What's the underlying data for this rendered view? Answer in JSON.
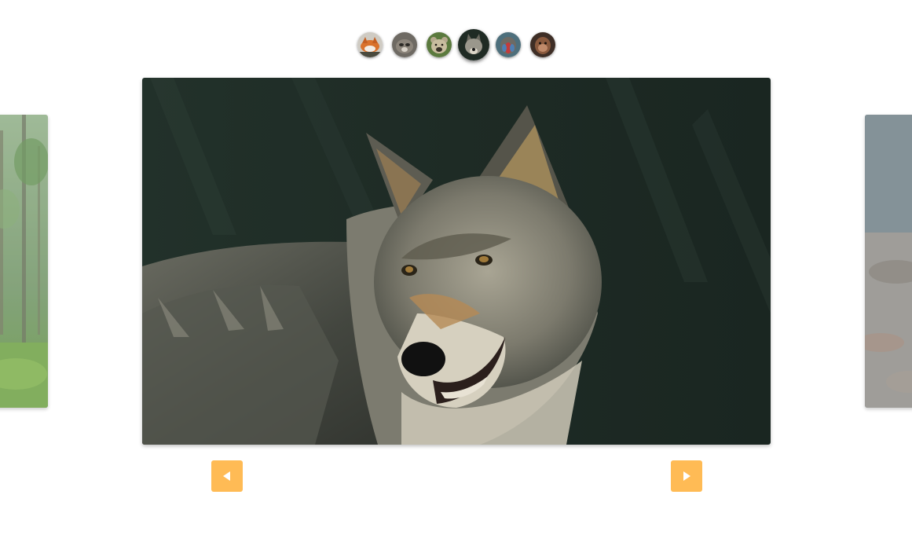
{
  "carousel": {
    "thumbnails": [
      {
        "subject": "fox",
        "active": false
      },
      {
        "subject": "raccoon",
        "active": false
      },
      {
        "subject": "bear",
        "active": false
      },
      {
        "subject": "wolf",
        "active": true
      },
      {
        "subject": "mandrill",
        "active": false
      },
      {
        "subject": "monkey",
        "active": false
      }
    ],
    "current_slide": {
      "subject": "wolf",
      "index": 4,
      "total": 6
    },
    "prev_slide": {
      "subject": "forest"
    },
    "next_slide": {
      "subject": "rocky-ground"
    },
    "controls": {
      "prev_icon": "triangle-left-icon",
      "next_icon": "triangle-right-icon"
    }
  },
  "colors": {
    "button": "#ffbb55",
    "button_icon": "#ffffff",
    "background": "#ffffff"
  }
}
